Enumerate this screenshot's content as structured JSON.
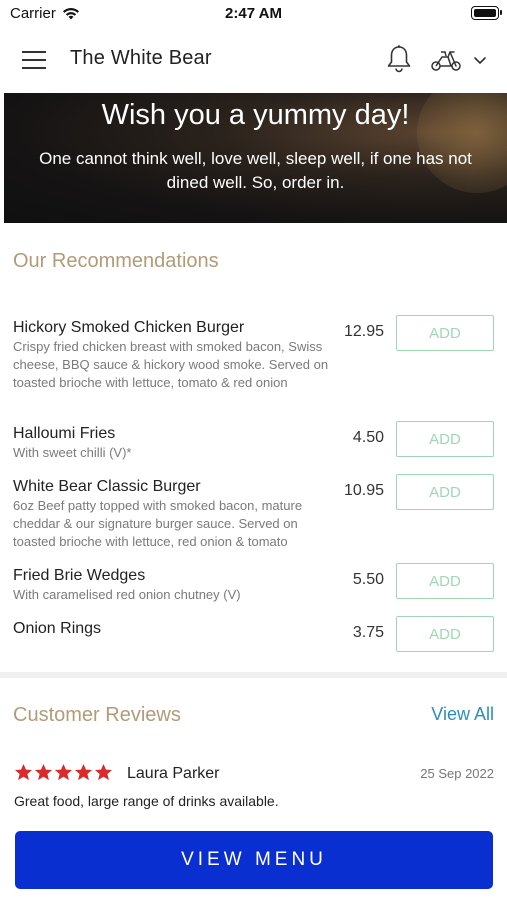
{
  "status_bar": {
    "carrier": "Carrier",
    "time": "2:47 AM"
  },
  "header": {
    "title": "The White Bear"
  },
  "banner": {
    "title": "Wish you a yummy day!",
    "text": "One cannot think well, love well, sleep well, if one has not dined well. So, order in."
  },
  "recommendations": {
    "title": "Our Recommendations",
    "add_label": "ADD",
    "items": [
      {
        "name": "Hickory Smoked Chicken Burger",
        "description": "Crispy fried chicken breast with smoked bacon, Swiss cheese, BBQ sauce & hickory wood smoke. Served on toasted brioche with lettuce, tomato & red onion",
        "price": "12.95"
      },
      {
        "name": "Halloumi Fries",
        "description": "With sweet chilli (V)*",
        "price": "4.50"
      },
      {
        "name": "White Bear Classic Burger",
        "description": "6oz Beef patty topped with smoked bacon, mature cheddar  & our signature burger sauce. Served on toasted brioche with lettuce, red onion & tomato",
        "price": "10.95"
      },
      {
        "name": "Fried Brie Wedges",
        "description": "With caramelised red onion chutney (V)",
        "price": "5.50"
      },
      {
        "name": "Onion Rings",
        "description": "",
        "price": "3.75"
      }
    ]
  },
  "reviews": {
    "title": "Customer Reviews",
    "view_all": "View All",
    "items": [
      {
        "reviewer": "Laura Parker",
        "date": "25 Sep 2022",
        "text": "Great food, large range of drinks available.",
        "rating": 5
      }
    ]
  },
  "footer": {
    "view_menu": "VIEW MENU"
  },
  "colors": {
    "accent_gold": "#b39a78",
    "add_green": "#9ed8b4",
    "link_blue": "#2a8fc0",
    "button_blue": "#0a2fd0",
    "star_red": "#d92b2b"
  }
}
